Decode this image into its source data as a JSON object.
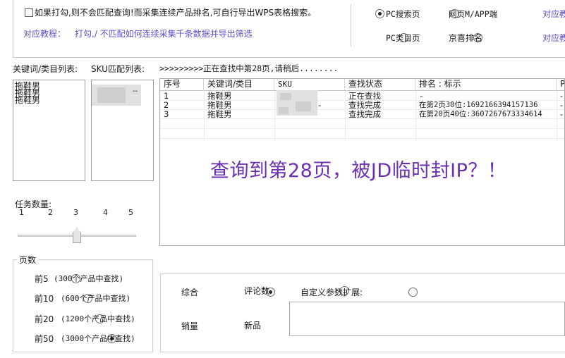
{
  "options": {
    "checkbox_label": "如果打勾,则不会匹配查询!而采集连续产品排名,可自行导出WPS表格搜索。",
    "tutorial_label": "对应教程：",
    "tutorial_link": "打勾,/ 不匹配如何连续采集千条数据并导出筛选",
    "search_modes": [
      {
        "label": "PC搜索页",
        "selected": true
      },
      {
        "label": "网页M/APP端",
        "selected": false
      },
      {
        "label": "PC类目页",
        "selected": false
      },
      {
        "label": "京喜排名",
        "selected": false
      }
    ],
    "right_links": [
      "对应教",
      "对应教"
    ]
  },
  "keywords": {
    "label": "关键词/类目列表:",
    "items": [
      "拖鞋男",
      "拖鞋男",
      "拖鞋男"
    ]
  },
  "sku_list": {
    "label": "SKU匹配列表:",
    "trailing_text": "--"
  },
  "status_text": ">>>>>>>>>正在查找中第28页,请稍后........",
  "table": {
    "headers": [
      "序号",
      "关键词/类目",
      "SKU",
      "查找状态",
      "排名 : 标示",
      "P"
    ],
    "rows": [
      [
        "1",
        "拖鞋男",
        "",
        "正在查找",
        "-",
        "-"
      ],
      [
        "2",
        "拖鞋男",
        "-",
        "查找完成",
        "在第2页30位:1692166394157136",
        "-"
      ],
      [
        "3",
        "拖鞋男",
        "",
        "查找完成",
        "在第20页40位:3607267673334614",
        "-"
      ]
    ]
  },
  "overlay_message": "查询到第28页，被JD临时封IP？！",
  "tasks": {
    "label": "任务数量:",
    "ticks": [
      "1",
      "2",
      "3",
      "4",
      "5"
    ],
    "value": 3
  },
  "pages": {
    "title": "页数",
    "options": [
      {
        "label": "前5",
        "note": "(300个产品中查找)",
        "selected": false
      },
      {
        "label": "前10",
        "note": "(600个产品中查找)",
        "selected": false
      },
      {
        "label": "前20",
        "note": "(1200个产品中查找)",
        "selected": false
      },
      {
        "label": "前50",
        "note": "(3000个产品中查找)",
        "selected": true
      }
    ]
  },
  "sort": {
    "options": [
      {
        "label": "综合",
        "selected": true
      },
      {
        "label": "评论数",
        "selected": false
      },
      {
        "label": "销量",
        "selected": false
      },
      {
        "label": "新品",
        "selected": false
      }
    ],
    "custom_label": "自定义参数扩展:",
    "custom_selected": false
  }
}
